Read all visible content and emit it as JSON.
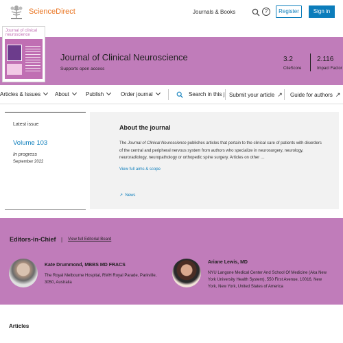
{
  "header": {
    "brand": "ScienceDirect",
    "journals_link": "Journals & Books",
    "help_glyph": "?",
    "register_label": "Register",
    "signin_label": "Sign in"
  },
  "journal": {
    "cover_title": "Journal of clinical neuroscience",
    "title": "Journal of Clinical Neuroscience",
    "subtitle": "Supports open access",
    "metrics": [
      {
        "value": "3.2",
        "label": "CiteScore"
      },
      {
        "value": "2.116",
        "label": "Impact Factor"
      }
    ]
  },
  "nav": {
    "items": [
      {
        "label": "Articles & Issues",
        "has_chevron": true
      },
      {
        "label": "About",
        "has_chevron": true
      },
      {
        "label": "Publish",
        "has_chevron": true
      },
      {
        "label": "Order journal",
        "has_chevron": true
      }
    ],
    "search_placeholder": "Search in this jo",
    "submit_label": "Submit your article",
    "guide_label": "Guide for authors"
  },
  "latest_issue": {
    "heading": "Latest issue",
    "volume": "Volume 103",
    "status": "In progress",
    "date": "September 2022"
  },
  "about": {
    "title": "About the journal",
    "text_prefix": "The ",
    "text_journal": "Journal of Clinical Neuroscience",
    "text_rest": " publishes articles that pertain to the clinical care of patients with disorders of the central and peripheral nervous system from authors who specialize in neurosurgery, neurology, neuroradiology, neuropathology or orthopedic spine surgery. Articles on other …",
    "aims_link": "View full aims & scope",
    "news_link": "News"
  },
  "editors": {
    "title": "Editors-in-Chief",
    "separator": "|",
    "board_link": "View full Editorial Board",
    "people": [
      {
        "name": "Kate Drummond, MBBS MD FRACS",
        "affiliation": "The Royal Melbourne Hospital, RMH Royal Parade, Parkville, 3050, Australia"
      },
      {
        "name": "Ariane Lewis, MD",
        "affiliation": "NYU Langone Medical Center And School Of Medicine (Aka New York University Health System), 550 First Avenue, 10016, New York, New York, United States of America"
      }
    ]
  },
  "articles": {
    "heading": "Articles"
  },
  "colors": {
    "brand_orange": "#e9711c",
    "accent_blue": "#0c7dbb",
    "journal_purple": "#c07cba"
  },
  "icons": [
    "elsevier-tree-logo",
    "search-icon",
    "help-icon",
    "chevron-down-icon",
    "external-arrow-icon",
    "news-arrow-icon"
  ]
}
